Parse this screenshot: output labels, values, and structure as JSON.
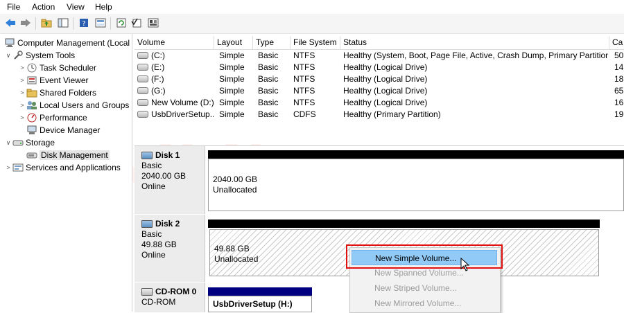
{
  "menu": {
    "file": "File",
    "action": "Action",
    "view": "View",
    "help": "Help"
  },
  "tree": {
    "root": "Computer Management (Local",
    "system_tools": "System Tools",
    "task_scheduler": "Task Scheduler",
    "event_viewer": "Event Viewer",
    "shared_folders": "Shared Folders",
    "local_users": "Local Users and Groups",
    "performance": "Performance",
    "device_manager": "Device Manager",
    "storage": "Storage",
    "disk_management": "Disk Management",
    "services": "Services and Applications"
  },
  "volumes": {
    "headers": [
      "Volume",
      "Layout",
      "Type",
      "File System",
      "Status",
      "Ca"
    ],
    "rows": [
      [
        "(C:)",
        "Simple",
        "Basic",
        "NTFS",
        "Healthy (System, Boot, Page File, Active, Crash Dump, Primary Partition)",
        "50"
      ],
      [
        "(E:)",
        "Simple",
        "Basic",
        "NTFS",
        "Healthy (Logical Drive)",
        "14"
      ],
      [
        "(F:)",
        "Simple",
        "Basic",
        "NTFS",
        "Healthy (Logical Drive)",
        "18"
      ],
      [
        "(G:)",
        "Simple",
        "Basic",
        "NTFS",
        "Healthy (Logical Drive)",
        "65"
      ],
      [
        "New Volume (D:)",
        "Simple",
        "Basic",
        "NTFS",
        "Healthy (Logical Drive)",
        "16"
      ],
      [
        "UsbDriverSetup...",
        "Simple",
        "Basic",
        "CDFS",
        "Healthy (Primary Partition)",
        "19"
      ]
    ]
  },
  "disks": {
    "disk1": {
      "name": "Disk 1",
      "type": "Basic",
      "size": "2040.00 GB",
      "status": "Online",
      "part_size": "2040.00 GB",
      "part_label": "Unallocated"
    },
    "disk2": {
      "name": "Disk 2",
      "type": "Basic",
      "size": "49.88 GB",
      "status": "Online",
      "part_size": "49.88 GB",
      "part_label": "Unallocated"
    },
    "cdrom": {
      "name": "CD-ROM 0",
      "type": "CD-ROM",
      "part_label": "UsbDriverSetup  (H:)"
    }
  },
  "context_menu": {
    "new_simple": "New Simple Volume...",
    "new_spanned": "New Spanned Volume...",
    "new_striped": "New Striped Volume...",
    "new_mirrored": "New Mirrored Volume..."
  },
  "watermark": "DeviceTricks",
  "colors": {
    "highlight": "#91c9f7",
    "red_outline": "#e01010",
    "disk_bar": "#000000",
    "cdrom_bar": "#000080"
  }
}
